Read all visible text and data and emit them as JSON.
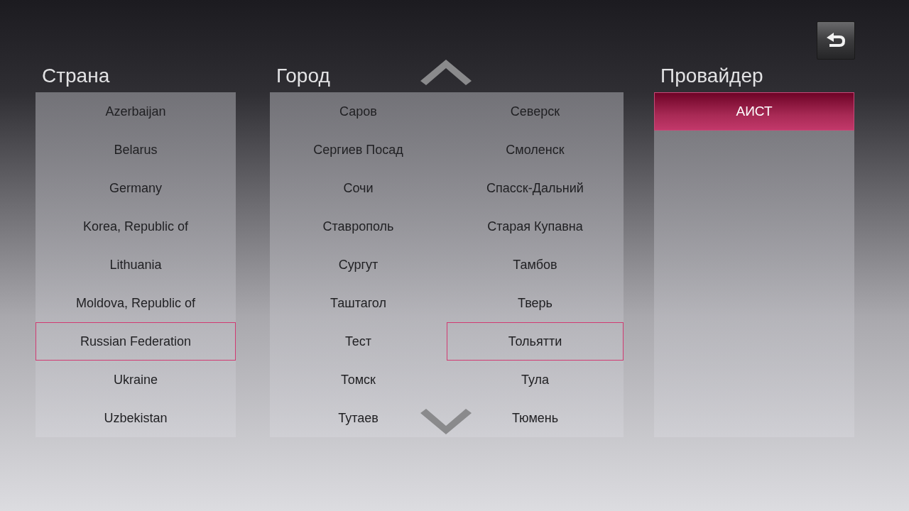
{
  "country": {
    "title": "Страна",
    "items": [
      {
        "label": "Azerbaijan",
        "selected": false
      },
      {
        "label": "Belarus",
        "selected": false
      },
      {
        "label": "Germany",
        "selected": false
      },
      {
        "label": "Korea, Republic of",
        "selected": false
      },
      {
        "label": "Lithuania",
        "selected": false
      },
      {
        "label": "Moldova, Republic of",
        "selected": false
      },
      {
        "label": "Russian Federation",
        "selected": true
      },
      {
        "label": "Ukraine",
        "selected": false
      },
      {
        "label": "Uzbekistan",
        "selected": false
      }
    ]
  },
  "city": {
    "title": "Город",
    "items": [
      {
        "label": "Саров",
        "selected": false
      },
      {
        "label": "Северск",
        "selected": false
      },
      {
        "label": "Сергиев Посад",
        "selected": false
      },
      {
        "label": "Смоленск",
        "selected": false
      },
      {
        "label": "Сочи",
        "selected": false
      },
      {
        "label": "Спасск-Дальний",
        "selected": false
      },
      {
        "label": "Ставрополь",
        "selected": false
      },
      {
        "label": "Старая Купавна",
        "selected": false
      },
      {
        "label": "Сургут",
        "selected": false
      },
      {
        "label": "Тамбов",
        "selected": false
      },
      {
        "label": "Таштагол",
        "selected": false
      },
      {
        "label": "Тверь",
        "selected": false
      },
      {
        "label": "Тест",
        "selected": false
      },
      {
        "label": "Тольятти",
        "selected": true
      },
      {
        "label": "Томск",
        "selected": false
      },
      {
        "label": "Тула",
        "selected": false
      },
      {
        "label": "Тутаев",
        "selected": false
      },
      {
        "label": "Тюмень",
        "selected": false
      }
    ]
  },
  "provider": {
    "title": "Провайдер",
    "items": [
      {
        "label": "АИСТ",
        "selected": true
      }
    ]
  }
}
